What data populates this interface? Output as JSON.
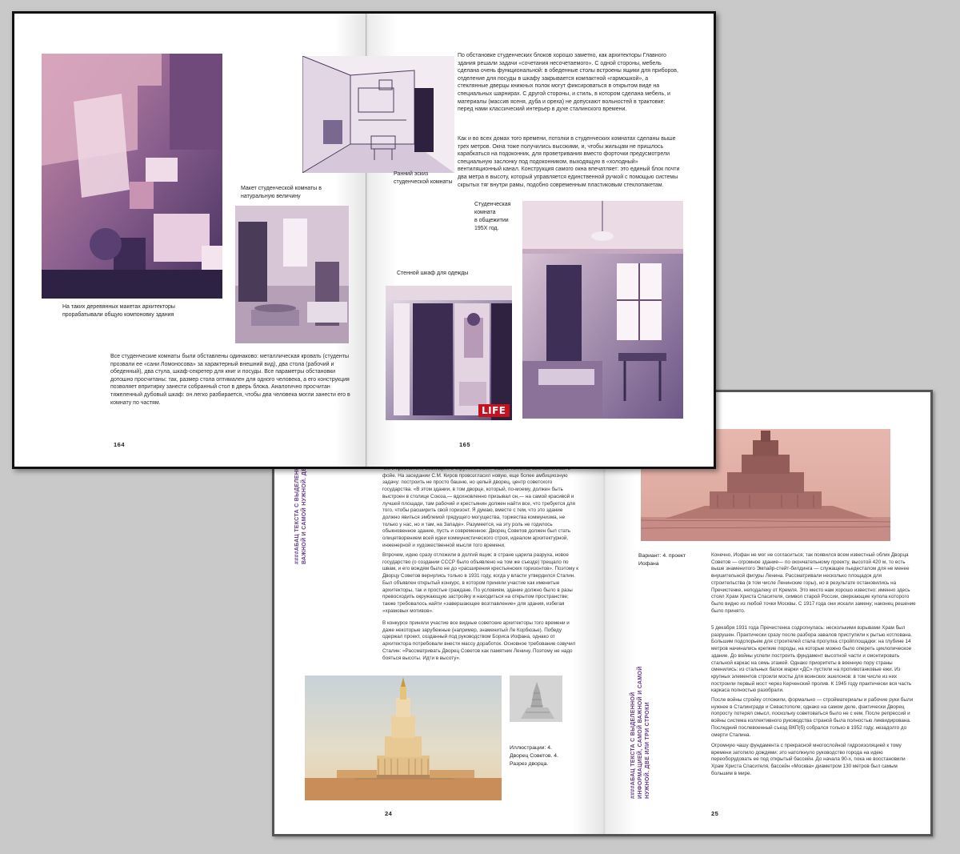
{
  "front_spread": {
    "left_page": {
      "caption_model": "На таких деревянных макетах архитекторы прорабатывали общую компоновку здания",
      "caption_full_scale": "Макет студенческой комнаты в натуральную величину",
      "body": "Все студенческие комнаты были обставлены одинаково: металлическая кровать (студенты прозвали ее «сани Ломоносова» за характерный внешний вид), два стола (рабочий и обеденный), два стула, шкаф-секретер для книг и посуды. Все параметры обстановки дотошно просчитаны: так, размер стола оптимален для одного человека, а его конструкция позволяет впритирку занести собранный стол в дверь блока. Аналогично просчитан тяжеленный дубовый шкаф: он легко разбирается, чтобы два человека могли занести его в комнату по частям.",
      "page_number": "164"
    },
    "right_page": {
      "body_1": "По обстановке студенческих блоков хорошо заметно, как архитекторы Главного здания решали задачи «сочетания несочетаемого». С одной стороны, мебель сделана очень функциональной: в обеденные столы встроены ящики для приборов, отделение для посуды в шкафу закрывается компактной «гармошкой», а стеклянные дверцы книжных полок могут фиксироваться в открытом виде на специальных шарнирах. С другой стороны, и стиль, в котором сделана мебель, и материалы (массив ясеня, дуба и ореха) не допускают вольностей в трактовке: перед нами классический интерьер в духе сталинского времени.",
      "body_2": "Как и во всех домах того времени, потолки в студенческих комнатах сделаны выше трех метров. Окна тоже получились высокими, и, чтобы жильцам не пришлось карабкаться на подоконник, для проветривания вместо форточки предусмотрели специальную заслонку под подоконником, выходящую в «холодный» вентиляционный канал. Конструкция самого окна впечатляет: это единый блок почти два метра в высоту, который управляется единственной ручкой с помощью системы скрытых тяг внутри рамы, подобно современным пластиковым стеклопакетам.",
      "caption_sketch": "Ранний эскиз\nстуденческой комнаты",
      "caption_dorm": "Студенческая\nкомната\nв общежитии\n195Х год.",
      "caption_wardrobe": "Стенной шкаф для одежды",
      "life_logo": "LIFE",
      "page_number": "165"
    }
  },
  "back_spread": {
    "vertical_heading_left": "####АБАЦ ТЕКСТА С ВЫДЕЛЕННОЙ ИНФОРМАЦИЕЙ, САМОЙ\nВАЖНОЙ И САМОЙ НУЖНОЙ. ДВЕ ИЛИ ТРИ СТРОКИ.",
    "vertical_heading_right": "####АБАЦ ТЕКСТА С ВЫДЕЛЕННОЙ\nИНФОРМАЦИЕЙ, САМОЙ ВАЖНОЙ И САМОЙ\nНУЖНОЙ. ДВЕ ИЛИ ТРИ СТРОКИ",
    "left_page": {
      "para_1": "чих и крестьянин, восхищенно окружили макет башни Татлина, выставленный в фойе. На заседании С.М. Киров провозгласил новую, еще более амбициозную задачу: построить не просто башню, но целый дворец, центр советского государства. «В этом здании, в том дворце, который, по-моему, должен быть выстроен в столице Союза,— вдохновленно призывал он,— на самой красивой и лучшей площади, там рабочий и крестьянин должен найти все, что требуется для того, чтобы расширить свой горизонт. Я думаю, вместе с тем, что это здание должно явиться эмблемой грядущего могущества, торжества коммунизма, не только у нас, но и там, на Западе». Разумеется, на эту роль не годилось обыкновенное здание, пусть и современное: Дворец Советов должен был стать олицетворением всей идеи коммунистического строя, идеалом архитектурной, инженерной и художественной мысли того времени.",
      "para_2": "Впрочем, идею сразу отложили в долгий ящик: в стране царила разруха, новое государство (о создании СССР было объявлено на том же съезде) трещало по швам, и его вождям было не до «расширения крестьянских горизонтов». Поэтому к Дворцу Советов вернулись только в 1931 году, когда у власти утвердился Сталин. Был объявлен открытый конкурс, в котором приняли участие как именитые архитекторы, так и простые граждане. По условиям, здание должно было в разы превосходить окружающую застройку и находиться на открытом пространстве; также требовалось найти «завершающее возглавление» для здания, избегая «храмовых мотивов».",
      "para_3": "В конкурсе приняли участие все видные советские архитекторы того времени и даже некоторые зарубежные (например, знаменитый Ле Корбюзье). Победу одержал проект, созданный под руководством Бориса Иофана, однако от архитектора потребовали внести массу доработок. Основное требование озвучил Сталин: «Рассматривать Дворец Советов как памятник Ленину. Поэтому не надо бояться высоты. Идти в высоту».",
      "caption_illustrations": "Иллюстрации: 4.\nДворец Советов. 4.\nРазрез дворца.",
      "page_number": "24"
    },
    "right_page": {
      "caption_variant": "Вариант: 4. проект\nИофана",
      "para_1": "Конечно, Иофан не мог не согласиться; так появился всем известный облик Дворца Советов — огромное здание— по окончательному проекту, высотой 420 м, то есть выше знаменитого Эмпайр-стейт-билдинга — служащее пьедесталом для не менее внушительной фигуры Ленина. Рассматривали несколько площадок для строительства (в том числе Ленинские горы), но в результате остановились на Пречистенке, неподалеку от Кремля. Это место нам хорошо известно: именно здесь стоял Храм Христа Спасителя, символ старой России, сверкающие купола которого было видно из любой точки Москвы. С 1917 года они искали замену; наконец решение было принято.",
      "para_2": "5 декабря 1931 года Пречистенка содрогнулась: несколькими взрывами Храм был разрушен. Практически сразу после разбора завалов приступили к рытью котлована. Большим подспорьем для строителей стала прогулка стройплощадки: на глубине 14 метров начинались крепкие породы, на которые можно было опереть циклопическое здание. До войны успели построить фундамент высотной части и смонтировать стальной каркас на семь этажей. Однако приоритеты в военную пору страны сменились: из стальных балок марки «ДС» пустили на противотанковые ежи. Из крупных элементов строили мосты для воинских эшелонов: в том числе из них построили первый мост через Керченский пролив. К 1945 году практически вся часть каркаса полностью разобрали.",
      "para_3": "После войны стройку отложили, формально — стройматериалы и рабочие руки были нужнее в Сталинграде и Севастополе; однако на самом деле, фактически Дворец попросту потерял смысл, поскольку советоваться было не с кем. После репрессий и войны система коллективного руководства страной была полностью ликвидирована. Последний послевоенный съезд ВКП(б) собрался только в 1952 году, незадолго до смерти Сталина.",
      "para_4": "Огромную чашу фундамента с прекрасной многослойной гидроизоляцией к тому времени затопило дождями: это натолкнуло руководство города на идею переоборудовать ее под открытый бассейн. До начала 90-х, пока не восстановили Храм Христа Спасителя, бассейн «Москва» диаметром 130 метров был самым большим в мире.",
      "page_number": "25"
    }
  },
  "colors": {
    "background": "#c9c9c9",
    "accent_purple": "#6a3c8c",
    "tint_pink": "#b66a86"
  }
}
